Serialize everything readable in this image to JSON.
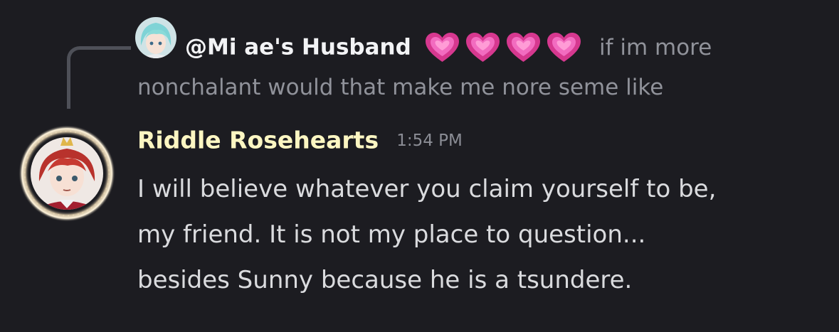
{
  "reply": {
    "username": "@Mi ae's Husband",
    "heart_emoji_count": 4,
    "heart_emoji_name": "heart-emoji",
    "text_part1": "if im more",
    "text_part2": "nonchalant would that make me nore seme like"
  },
  "message": {
    "author": "Riddle Rosehearts",
    "timestamp": "1:54 PM",
    "lines": [
      "I will believe whatever you claim yourself to be,",
      "my friend. It is not my place to question...",
      "besides Sunny because he is a tsundere."
    ]
  },
  "colors": {
    "background": "#1c1c21",
    "author_name": "#fcf6c2",
    "reply_username": "#f2f3f5",
    "muted_text": "#90929a",
    "body_text": "#dadbde",
    "heart_pink": "#e84aa8"
  }
}
